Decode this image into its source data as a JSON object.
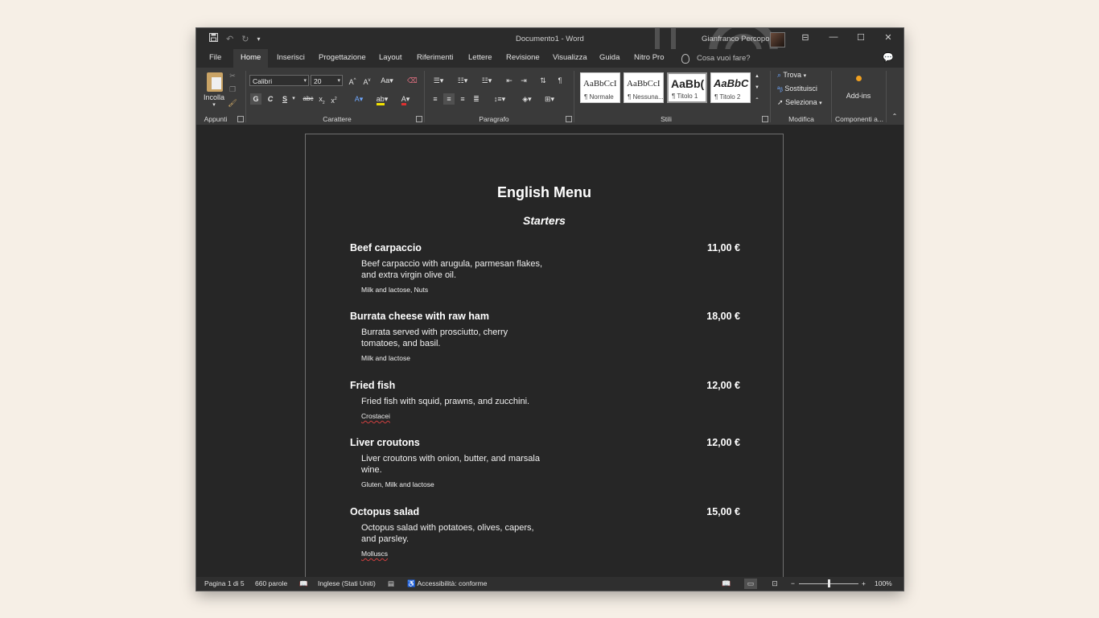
{
  "window": {
    "doc_title": "Documento1  -  Word",
    "user_name": "Gianfranco Percopo"
  },
  "qat": {
    "save_icon": "save-icon",
    "undo_icon": "undo-icon",
    "redo_icon": "redo-icon",
    "customize_icon": "customize-qat-icon"
  },
  "tabs": [
    {
      "label": "File"
    },
    {
      "label": "Home"
    },
    {
      "label": "Inserisci"
    },
    {
      "label": "Progettazione"
    },
    {
      "label": "Layout"
    },
    {
      "label": "Riferimenti"
    },
    {
      "label": "Lettere"
    },
    {
      "label": "Revisione"
    },
    {
      "label": "Visualizza"
    },
    {
      "label": "Guida"
    },
    {
      "label": "Nitro Pro"
    }
  ],
  "active_tab": "Home",
  "tell_me": "Cosa vuoi fare?",
  "ribbon": {
    "clipboard": {
      "paste_label": "Incolla",
      "group_label": "Appunti"
    },
    "font": {
      "font_name": "Calibri",
      "font_size": "20",
      "group_label": "Carattere",
      "buttons": [
        "G",
        "C",
        "S",
        "abc",
        "x",
        "x",
        "A"
      ]
    },
    "paragraph": {
      "group_label": "Paragrafo"
    },
    "styles": {
      "group_label": "Stili",
      "items": [
        {
          "preview": "AaBbCcI",
          "name": "¶ Normale"
        },
        {
          "preview": "AaBbCcI",
          "name": "¶ Nessuna..."
        },
        {
          "preview": "AaBb(",
          "name": "¶ Titolo 1"
        },
        {
          "preview": "AaBbC",
          "name": "¶ Titolo 2"
        }
      ]
    },
    "editing": {
      "group_label": "Modifica",
      "find": "Trova",
      "replace": "Sostituisci",
      "select": "Seleziona"
    },
    "addins": {
      "label": "Add-ins",
      "group_label": "Componenti a..."
    }
  },
  "document": {
    "title": "English Menu",
    "section": "Starters",
    "dishes": [
      {
        "name": "Beef carpaccio",
        "price": "11,00 €",
        "description": "Beef carpaccio with arugula, parmesan flakes, and extra virgin olive oil.",
        "allergens": "Milk and lactose, Nuts"
      },
      {
        "name": "Burrata cheese with raw ham",
        "price": "18,00 €",
        "description": "Burrata served with prosciutto, cherry tomatoes, and basil.",
        "allergens": "Milk and lactose"
      },
      {
        "name": "Fried fish",
        "price": "12,00 €",
        "description": "Fried fish with squid, prawns, and zucchini.",
        "allergens": "Crostacei"
      },
      {
        "name": "Liver croutons",
        "price": "12,00 €",
        "description": "Liver croutons with onion, butter, and marsala wine.",
        "allergens": "Gluten, Milk and lactose"
      },
      {
        "name": "Octopus salad",
        "price": "15,00 €",
        "description": "Octopus salad with potatoes, olives, capers, and parsley.",
        "allergens": "Molluscs"
      }
    ]
  },
  "statusbar": {
    "page": "Pagina 1 di 5",
    "words": "660 parole",
    "language": "Inglese (Stati Uniti)",
    "accessibility": "Accessibilità: conforme",
    "zoom": "100%",
    "zoom_level": 0.5
  }
}
